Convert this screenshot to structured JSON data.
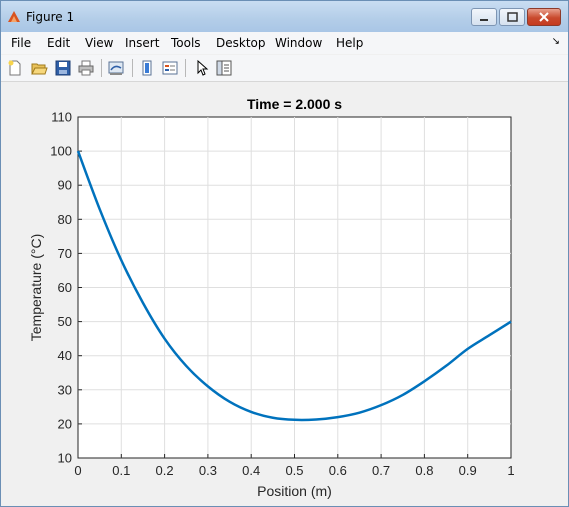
{
  "window": {
    "title": "Figure 1"
  },
  "menu": {
    "items": [
      "File",
      "Edit",
      "View",
      "Insert",
      "Tools",
      "Desktop",
      "Window",
      "Help"
    ]
  },
  "toolbar": {
    "icons": [
      "new-figure-icon",
      "open-file-icon",
      "save-icon",
      "print-icon",
      "link-plot-icon",
      "colorbar-icon",
      "legend-icon",
      "pointer-icon",
      "property-inspector-icon"
    ]
  },
  "chart_data": {
    "type": "line",
    "title": "Time = 2.000 s",
    "xlabel": "Position (m)",
    "ylabel": "Temperature (°C)",
    "xlim": [
      0,
      1
    ],
    "ylim": [
      10,
      110
    ],
    "xticks": [
      0,
      0.1,
      0.2,
      0.3,
      0.4,
      0.5,
      0.6,
      0.7,
      0.8,
      0.9,
      1
    ],
    "xtick_labels": [
      "0",
      "0.1",
      "0.2",
      "0.3",
      "0.4",
      "0.5",
      "0.6",
      "0.7",
      "0.8",
      "0.9",
      "1"
    ],
    "yticks": [
      10,
      20,
      30,
      40,
      50,
      60,
      70,
      80,
      90,
      100,
      110
    ],
    "ytick_labels": [
      "10",
      "20",
      "30",
      "40",
      "50",
      "60",
      "70",
      "80",
      "90",
      "100",
      "110"
    ],
    "grid": true,
    "line_color": "#0072bd",
    "series": [
      {
        "x": [
          0,
          0.05,
          0.1,
          0.15,
          0.2,
          0.25,
          0.3,
          0.35,
          0.4,
          0.45,
          0.5,
          0.55,
          0.6,
          0.65,
          0.7,
          0.75,
          0.8,
          0.85,
          0.9,
          0.95,
          1
        ],
        "y": [
          100,
          83,
          68,
          55.5,
          45,
          37,
          31,
          26.5,
          23.5,
          21.8,
          21.2,
          21.3,
          22,
          23.3,
          25.5,
          28.5,
          32.5,
          37,
          42,
          46,
          50
        ]
      }
    ]
  }
}
